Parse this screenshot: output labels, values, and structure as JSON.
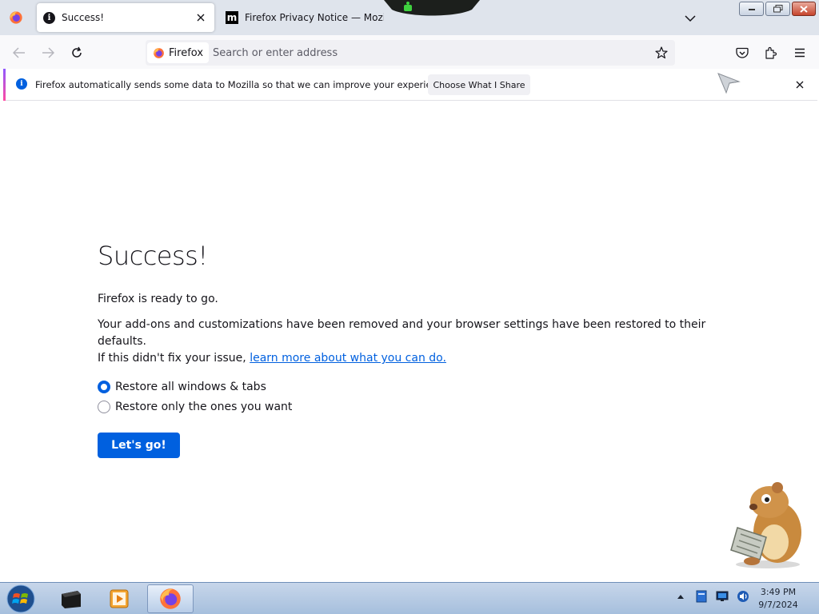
{
  "tabs": [
    {
      "title": "Success!",
      "active": true,
      "icon": "info-icon"
    },
    {
      "title": "Firefox Privacy Notice — Mozi",
      "active": false,
      "icon": "mozilla-icon"
    }
  ],
  "navbar": {
    "identity_label": "Firefox",
    "url_placeholder": "Search or enter address"
  },
  "notification": {
    "text": "Firefox automatically sends some data to Mozilla so that we can improve your experience.",
    "button_label": "Choose What I Share"
  },
  "content": {
    "heading": "Success!",
    "ready_text": "Firefox is ready to go.",
    "description_line1": "Your add-ons and customizations have been removed and your browser settings have been restored to their defaults.",
    "description_line2_prefix": "If this didn't fix your issue, ",
    "learn_more_link": "learn more about what you can do.",
    "options": [
      {
        "label": "Restore all windows & tabs",
        "checked": true
      },
      {
        "label": "Restore only the ones you want",
        "checked": false
      }
    ],
    "primary_button": "Let's go!"
  },
  "taskbar": {
    "time": "3:49 PM",
    "date": "9/7/2024"
  },
  "colors": {
    "accent": "#0060df",
    "tabstrip": "#dfe4ec",
    "taskbar": "#b3c8e3"
  }
}
